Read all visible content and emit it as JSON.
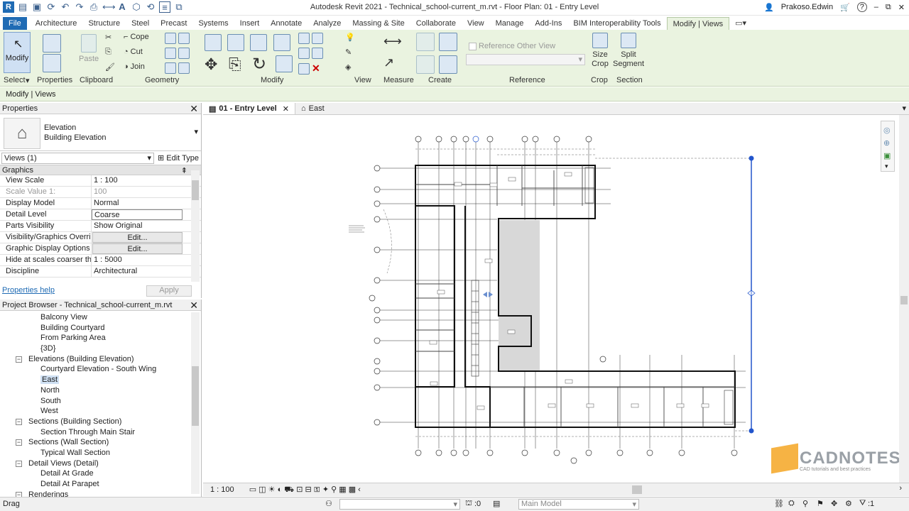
{
  "app": {
    "title": "Autodesk Revit 2021 - Technical_school-current_m.rvt - Floor Plan: 01 - Entry Level",
    "user": "Prakoso.Edwin",
    "win_min": "–",
    "win_max": "⧉",
    "win_close": "✕",
    "help": "?"
  },
  "ribbon_tabs": [
    "File",
    "Architecture",
    "Structure",
    "Steel",
    "Precast",
    "Systems",
    "Insert",
    "Annotate",
    "Analyze",
    "Massing & Site",
    "Collaborate",
    "View",
    "Manage",
    "Add-Ins",
    "BIM Interoperability Tools",
    "Modify | Views"
  ],
  "ribbon": {
    "modify": "Modify",
    "paste": "Paste",
    "cope": "Cope",
    "cut": "Cut",
    "join": "Join",
    "reference_other_view": "Reference Other View",
    "size_crop": "Size Crop",
    "split_segment": "Split Segment",
    "panels": [
      "Select",
      "Properties",
      "Clipboard",
      "Geometry",
      "Modify",
      "View",
      "Measure",
      "Create",
      "Reference",
      "Crop",
      "Section"
    ]
  },
  "options_bar": "Modify | Views",
  "properties": {
    "title": "Properties",
    "type_family": "Elevation",
    "type_name": "Building Elevation",
    "views_selector": "Views (1)",
    "edit_type": "Edit Type",
    "group": "Graphics",
    "rows": [
      {
        "k": "View Scale",
        "v": "1 : 100"
      },
      {
        "k": "Scale Value    1:",
        "v": "100"
      },
      {
        "k": "Display Model",
        "v": "Normal"
      },
      {
        "k": "Detail Level",
        "v": "Coarse"
      },
      {
        "k": "Parts Visibility",
        "v": "Show Original"
      },
      {
        "k": "Visibility/Graphics Overrid...",
        "v": "Edit..."
      },
      {
        "k": "Graphic Display Options",
        "v": "Edit..."
      },
      {
        "k": "Hide at scales coarser than",
        "v": "1 : 5000"
      },
      {
        "k": "Discipline",
        "v": "Architectural"
      }
    ],
    "help_link": "Properties help",
    "apply": "Apply"
  },
  "browser": {
    "title": "Project Browser - Technical_school-current_m.rvt",
    "items": [
      {
        "label": "Balcony View",
        "level": 2
      },
      {
        "label": "Building Courtyard",
        "level": 2
      },
      {
        "label": "From Parking Area",
        "level": 2
      },
      {
        "label": "{3D}",
        "level": 2
      },
      {
        "label": "Elevations (Building Elevation)",
        "level": 1
      },
      {
        "label": "Courtyard Elevation - South Wing",
        "level": 2
      },
      {
        "label": "East",
        "level": 2
      },
      {
        "label": "North",
        "level": 2
      },
      {
        "label": "South",
        "level": 2
      },
      {
        "label": "West",
        "level": 2
      },
      {
        "label": "Sections (Building Section)",
        "level": 1
      },
      {
        "label": "Section Through Main Stair",
        "level": 2
      },
      {
        "label": "Sections (Wall Section)",
        "level": 1
      },
      {
        "label": "Typical Wall Section",
        "level": 2
      },
      {
        "label": "Detail Views (Detail)",
        "level": 1
      },
      {
        "label": "Detail At Grade",
        "level": 2
      },
      {
        "label": "Detail At Parapet",
        "level": 2
      },
      {
        "label": "Renderings",
        "level": 1
      }
    ]
  },
  "view_tabs": [
    {
      "label": "01 - Entry Level",
      "close": "✕"
    },
    {
      "label": "East"
    }
  ],
  "view_control": {
    "scale": "1 : 100"
  },
  "status": {
    "text": "Drag",
    "count": ":0",
    "model": "Main Model",
    "filter": ":1"
  },
  "logo": {
    "name": "CADNOTES",
    "tagline": "CAD tutorials and best practices"
  }
}
